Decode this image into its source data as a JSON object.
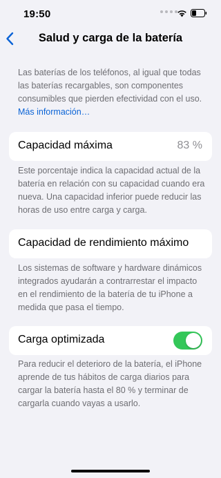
{
  "status_bar": {
    "time": "19:50",
    "icons": [
      "signal-dots",
      "wifi-icon",
      "battery-icon"
    ]
  },
  "nav": {
    "back_icon": "chevron-left-icon",
    "title": "Salud y carga de la batería"
  },
  "intro": {
    "text": "Las baterías de los teléfonos, al igual que todas las baterías recargables, son componentes consumibles que pierden efectividad con el uso.",
    "link": "Más información…"
  },
  "max_capacity": {
    "label": "Capacidad máxima",
    "value": "83 %",
    "footnote": "Este porcentaje indica la capacidad actual de la batería en relación con su capacidad cuando era nueva. Una capacidad inferior puede reducir las horas de uso entre carga y carga."
  },
  "peak_performance": {
    "label": "Capacidad de rendimiento máximo",
    "footnote": "Los sistemas de software y hardware dinámicos integrados ayudarán a contrarrestar el impacto en el rendimiento de la batería de tu iPhone a medida que pasa el tiempo."
  },
  "optimized_charging": {
    "label": "Carga optimizada",
    "enabled": true,
    "footnote": "Para reducir el deterioro de la batería, el iPhone aprende de tus hábitos de carga diarios para cargar la batería hasta el 80 % y terminar de cargarla cuando vayas a usarlo."
  },
  "colors": {
    "background": "#f2f2f7",
    "card": "#ffffff",
    "accent_blue": "#0a63d6",
    "toggle_on": "#34c759",
    "secondary_text": "#6e6e73"
  }
}
